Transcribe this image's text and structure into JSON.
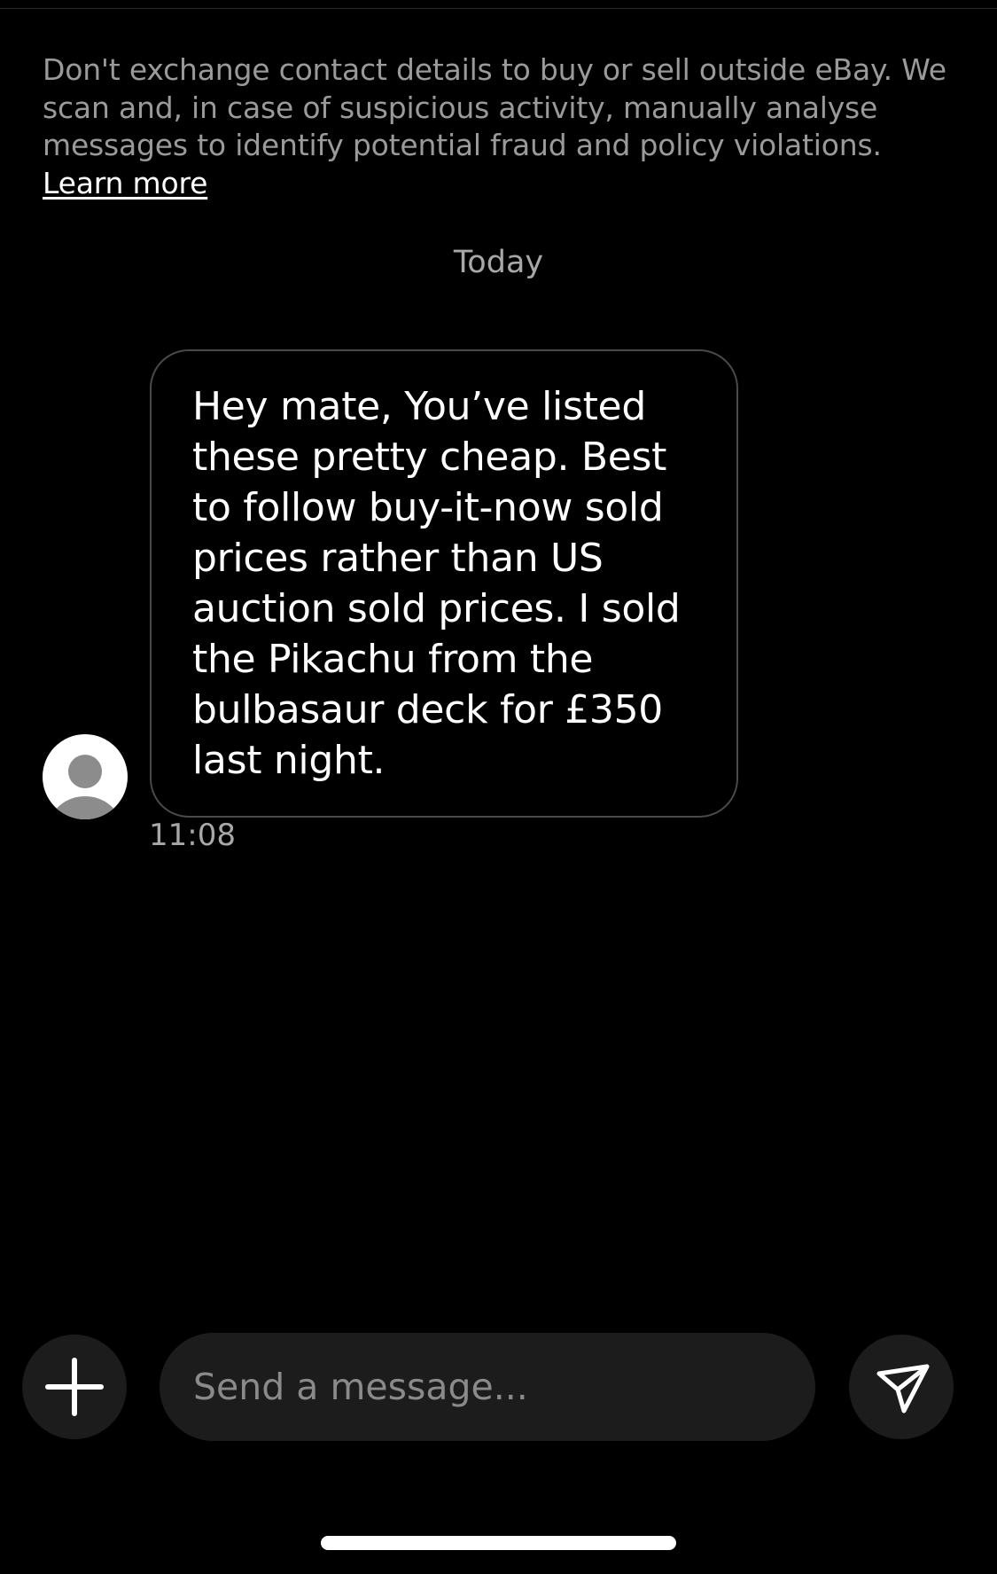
{
  "notice": {
    "text": "Don't exchange contact details to buy or sell outside eBay. We scan and, in case of suspicious activity, manually analyse messages to identify potential fraud and policy violations. ",
    "link_label": "Learn more"
  },
  "conversation": {
    "date_separator": "Today",
    "messages": [
      {
        "sender_avatar": "person-icon",
        "text": "Hey mate, You’ve listed these pretty cheap. Best to follow buy-it-now sold prices rather than US auction sold prices. I sold the Pikachu from the bulbasaur deck for £350 last night.",
        "time": "11:08"
      }
    ]
  },
  "composer": {
    "add_icon": "plus-icon",
    "placeholder": "Send a message...",
    "value": "",
    "send_icon": "send-icon"
  },
  "colors": {
    "background": "#000000",
    "surface": "#1c1c1c",
    "bubble_border": "#4a4a4a",
    "muted_text": "#9a9a9a",
    "text": "#ffffff"
  }
}
